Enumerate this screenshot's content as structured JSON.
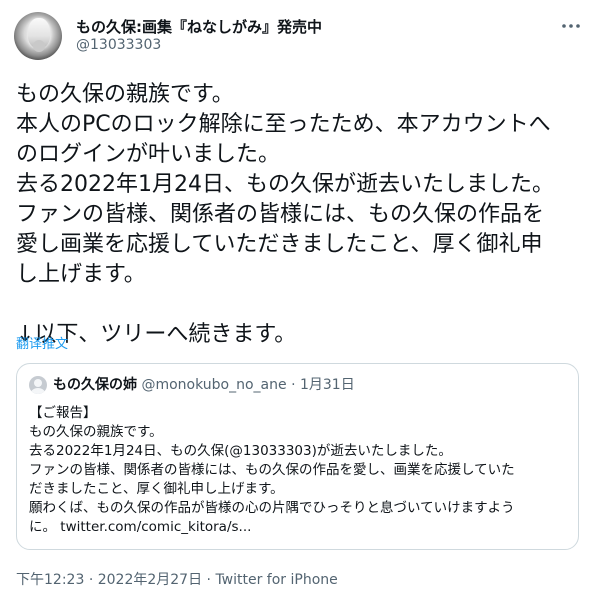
{
  "author": {
    "display_name": "もの久保:画集『ねなしがみ』発売中",
    "handle": "@13033303"
  },
  "tweet": {
    "lines": [
      "もの久保の親族です。",
      "本人のPCのロック解除に至ったため、本アカウントへ",
      "のログインが叶いました。",
      "去る2022年1月24日、もの久保が逝去いたしました。",
      "ファンの皆様、関係者の皆様には、もの久保の作品を",
      "愛し画業を応援していただきましたこと、厚く御礼申",
      "し上げます。",
      "",
      "↓以下、ツリーへ続きます。"
    ],
    "translate_label": "翻译推文"
  },
  "quote": {
    "display_name": "もの久保の姉",
    "handle": "@monokubo_no_ane",
    "separator": "·",
    "date": "1月31日",
    "lines": [
      "【ご報告】",
      "もの久保の親族です。",
      "去る2022年1月24日、もの久保(@13033303)が逝去いたしました。",
      "ファンの皆様、関係者の皆様には、もの久保の作品を愛し、画業を応援していた",
      "だきましたこと、厚く御礼申し上げます。",
      "願わくば、もの久保の作品が皆様の心の片隅でひっそりと息づいていけますよう",
      "に。 twitter.com/comic_kitora/s..."
    ]
  },
  "meta": {
    "time": "下午12:23",
    "sep1": "·",
    "date": "2022年2月27日",
    "sep2": "·",
    "source": "Twitter for iPhone"
  },
  "icons": {
    "more": "more-dots-icon"
  },
  "colors": {
    "text": "#0f1419",
    "secondary": "#536471",
    "link": "#1d9bf0",
    "border": "#cfd9de"
  }
}
